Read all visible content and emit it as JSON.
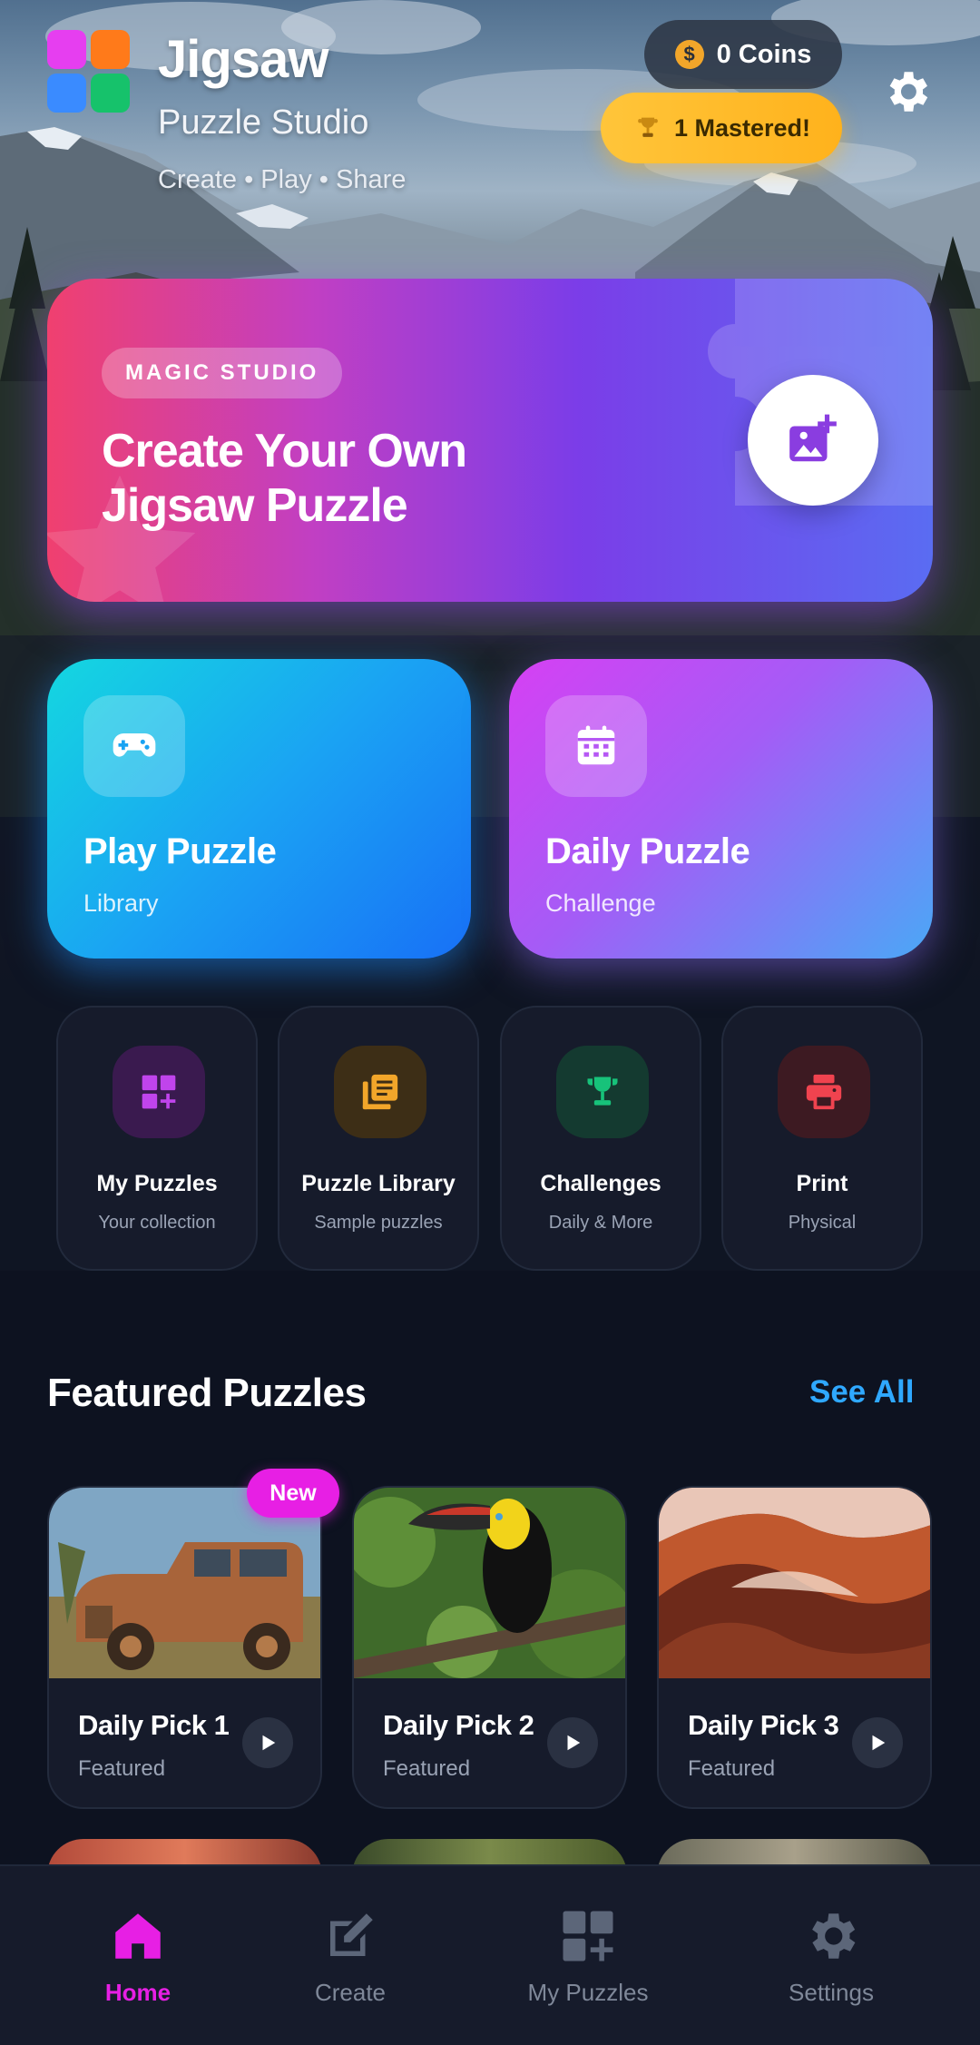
{
  "header": {
    "app_title": "Jigsaw",
    "app_subtitle": "Puzzle Studio",
    "tagline": "Create • Play • Share",
    "coins_label": "0 Coins",
    "coin_symbol": "$",
    "mastered_label": "1 Mastered!",
    "logo_colors": [
      "#e63ef0",
      "#ff7a1a",
      "#3a8bff",
      "#16c26b"
    ]
  },
  "hero": {
    "badge": "MAGIC STUDIO",
    "title": "Create Your Own Jigsaw Puzzle",
    "button_icon": "add-photo-icon"
  },
  "actions": [
    {
      "title": "Play Puzzle",
      "subtitle": "Library",
      "icon": "gamepad-icon"
    },
    {
      "title": "Daily Puzzle",
      "subtitle": "Challenge",
      "icon": "calendar-icon"
    }
  ],
  "tiles": [
    {
      "title": "My Puzzles",
      "subtitle": "Your collection",
      "icon": "grid-plus-icon",
      "color": "#b03ee0"
    },
    {
      "title": "Puzzle Library",
      "subtitle": "Sample puzzles",
      "icon": "library-icon",
      "color": "#f2a62a"
    },
    {
      "title": "Challenges",
      "subtitle": "Daily & More",
      "icon": "trophy-icon",
      "color": "#17c27a"
    },
    {
      "title": "Print",
      "subtitle": "Physical",
      "icon": "printer-icon",
      "color": "#f0434f"
    }
  ],
  "featured": {
    "title": "Featured Puzzles",
    "see_all": "See All",
    "new_badge": "New",
    "items": [
      {
        "title": "Daily Pick 1",
        "subtitle": "Featured",
        "image": "rusty-truck-photo"
      },
      {
        "title": "Daily Pick 2",
        "subtitle": "Featured",
        "image": "toucan-photo"
      },
      {
        "title": "Daily Pick 3",
        "subtitle": "Featured",
        "image": "canyon-photo"
      }
    ]
  },
  "nav": [
    {
      "label": "Home",
      "icon": "home-icon",
      "active": true
    },
    {
      "label": "Create",
      "icon": "edit-icon",
      "active": false
    },
    {
      "label": "My Puzzles",
      "icon": "grid-plus-icon",
      "active": false
    },
    {
      "label": "Settings",
      "icon": "gear-icon",
      "active": false
    }
  ],
  "colors": {
    "accent": "#e71fe4",
    "link": "#2fa8ff",
    "background": "#0d1220",
    "card": "#161b2b"
  }
}
